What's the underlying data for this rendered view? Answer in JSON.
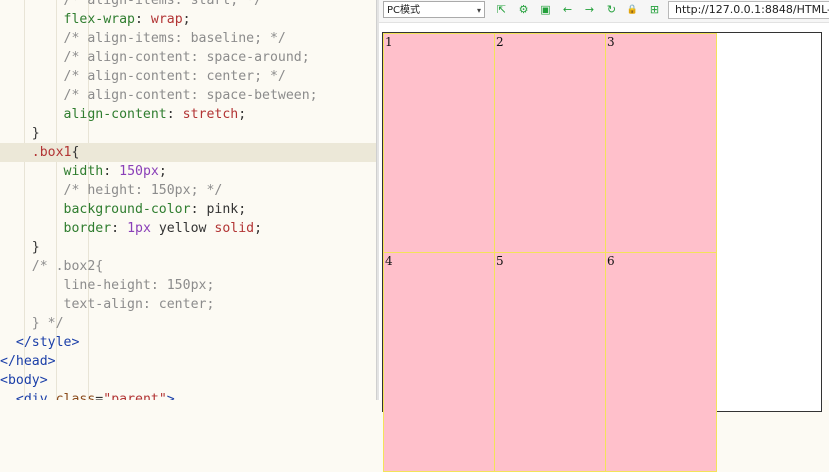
{
  "editor": {
    "lines": [
      [
        {
          "t": "        ",
          "c": "pn"
        },
        {
          "t": "/* align-items: start; */",
          "c": "cm"
        }
      ],
      [
        {
          "t": "        ",
          "c": "pn"
        },
        {
          "t": "flex-wrap",
          "c": "pr"
        },
        {
          "t": ": ",
          "c": "pn"
        },
        {
          "t": "wrap",
          "c": "vl"
        },
        {
          "t": ";",
          "c": "pn"
        }
      ],
      [
        {
          "t": "        ",
          "c": "pn"
        },
        {
          "t": "/* align-items: baseline; */",
          "c": "cm"
        }
      ],
      [
        {
          "t": "        ",
          "c": "pn"
        },
        {
          "t": "/* align-content: space-around;",
          "c": "cm"
        }
      ],
      [
        {
          "t": "        ",
          "c": "pn"
        },
        {
          "t": "/* align-content: center; */",
          "c": "cm"
        }
      ],
      [
        {
          "t": "        ",
          "c": "pn"
        },
        {
          "t": "/* align-content: space-between;",
          "c": "cm"
        }
      ],
      [
        {
          "t": "        ",
          "c": "pn"
        },
        {
          "t": "align-content",
          "c": "pr"
        },
        {
          "t": ": ",
          "c": "pn"
        },
        {
          "t": "stretch",
          "c": "vl"
        },
        {
          "t": ";",
          "c": "pn"
        }
      ],
      [
        {
          "t": "    }",
          "c": "pn"
        }
      ],
      [
        {
          "t": "    ",
          "c": "pn"
        },
        {
          "t": ".box1",
          "c": "sel"
        },
        {
          "t": "{",
          "c": "pn"
        }
      ],
      [
        {
          "t": "        ",
          "c": "pn"
        },
        {
          "t": "width",
          "c": "pr"
        },
        {
          "t": ": ",
          "c": "pn"
        },
        {
          "t": "150px",
          "c": "num"
        },
        {
          "t": ";",
          "c": "pn"
        }
      ],
      [
        {
          "t": "        ",
          "c": "pn"
        },
        {
          "t": "/* height: 150px; */",
          "c": "cm"
        }
      ],
      [
        {
          "t": "        ",
          "c": "pn"
        },
        {
          "t": "background-color",
          "c": "pr"
        },
        {
          "t": ": ",
          "c": "pn"
        },
        {
          "t": "pink",
          "c": "pn"
        },
        {
          "t": ";",
          "c": "pn"
        }
      ],
      [
        {
          "t": "        ",
          "c": "pn"
        },
        {
          "t": "border",
          "c": "pr"
        },
        {
          "t": ": ",
          "c": "pn"
        },
        {
          "t": "1px",
          "c": "num"
        },
        {
          "t": " yellow ",
          "c": "pn"
        },
        {
          "t": "solid",
          "c": "vl"
        },
        {
          "t": ";",
          "c": "pn"
        }
      ],
      [
        {
          "t": "    }",
          "c": "pn"
        }
      ],
      [
        {
          "t": "    ",
          "c": "pn"
        },
        {
          "t": "/* .box2{",
          "c": "cm"
        }
      ],
      [
        {
          "t": "        ",
          "c": "pn"
        },
        {
          "t": "line-height: 150px;",
          "c": "cm"
        }
      ],
      [
        {
          "t": "        ",
          "c": "pn"
        },
        {
          "t": "text-align: center;",
          "c": "cm"
        }
      ],
      [
        {
          "t": "    ",
          "c": "pn"
        },
        {
          "t": "} */",
          "c": "cm"
        }
      ],
      [
        {
          "t": "  ",
          "c": "pn"
        },
        {
          "t": "</style>",
          "c": "tg"
        }
      ],
      [
        {
          "t": "</head>",
          "c": "tg"
        }
      ],
      [
        {
          "t": "<body>",
          "c": "tg"
        }
      ],
      [
        {
          "t": "  ",
          "c": "pn"
        },
        {
          "t": "<div ",
          "c": "tg"
        },
        {
          "t": "class",
          "c": "at"
        },
        {
          "t": "=",
          "c": "pn"
        },
        {
          "t": "\"parent\"",
          "c": "st"
        },
        {
          "t": ">",
          "c": "tg"
        }
      ]
    ],
    "highlight_line": 8
  },
  "toolbar": {
    "mode": "PC模式",
    "url": "http://127.0.0.1:8848/HTML-",
    "icons": [
      "external-link-icon",
      "settings-gear-icon",
      "devtools-icon",
      "back-arrow-icon",
      "forward-arrow-icon",
      "refresh-icon",
      "lock-icon",
      "qr-code-icon"
    ],
    "icon_glyphs": [
      "⇱",
      "⚙",
      "▣",
      "←",
      "→",
      "↻",
      "🔒",
      "⊞"
    ]
  },
  "preview": {
    "boxes": [
      "1",
      "2",
      "3",
      "4",
      "5",
      "6"
    ],
    "box_color": "#ffc0cb",
    "box_border": "#f3e35a"
  }
}
